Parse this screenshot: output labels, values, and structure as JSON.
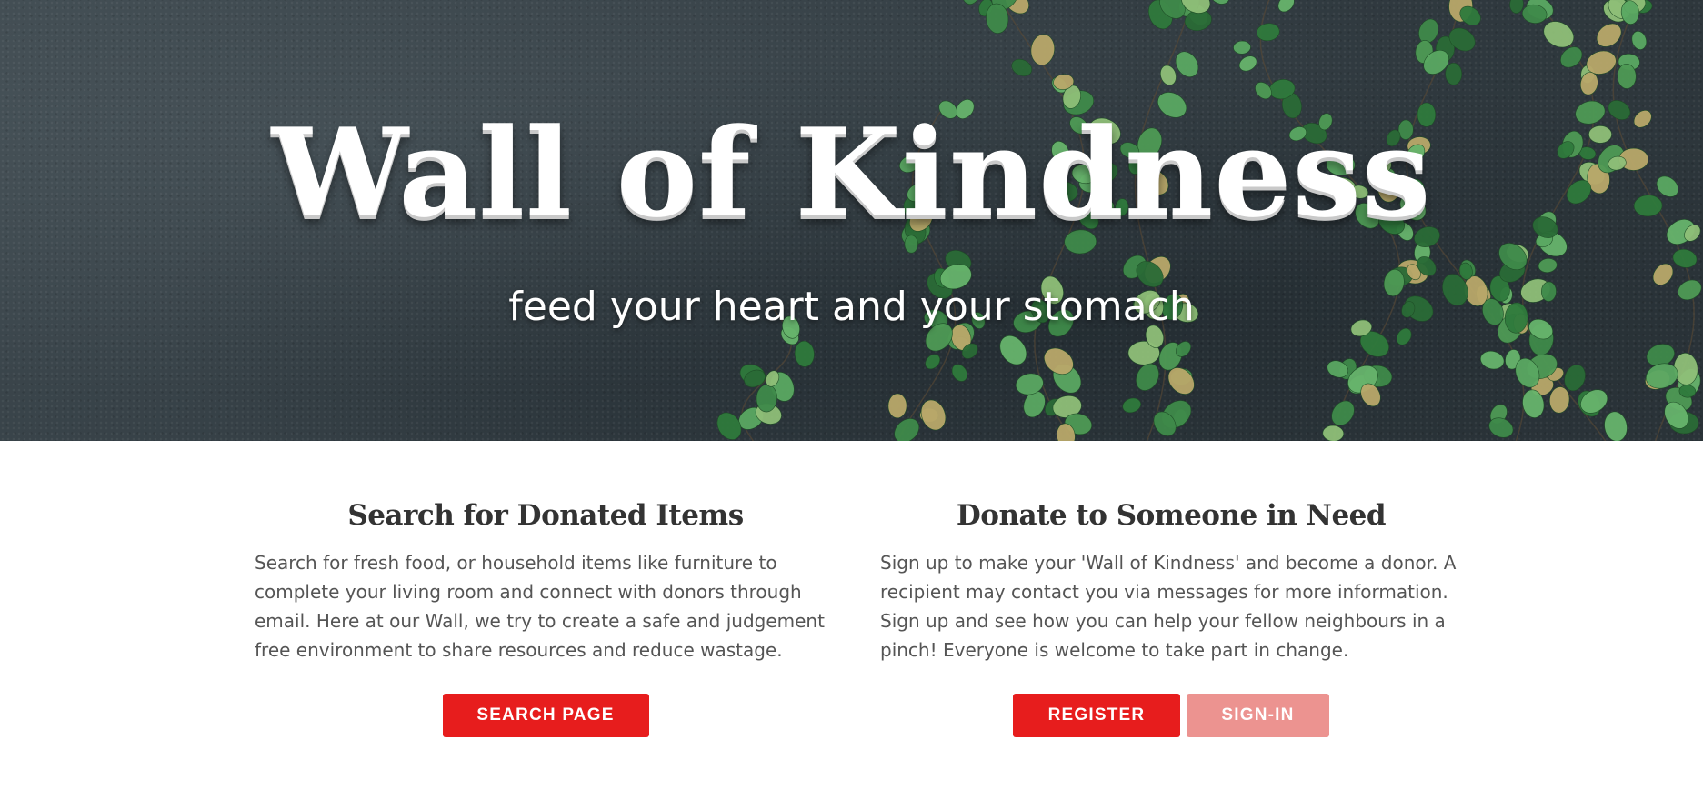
{
  "hero": {
    "title": "Wall of Kindness",
    "tagline": "feed your heart and your stomach"
  },
  "search_section": {
    "heading": "Search for Donated Items",
    "body": "Search for fresh food, or household items like furniture to complete your living room and connect with donors through email. Here at our Wall, we try to create a safe and judgement free environment to share resources and reduce wastage.",
    "button_label": "SEARCH PAGE"
  },
  "donate_section": {
    "heading": "Donate to Someone in Need",
    "body": "Sign up to make your 'Wall of Kindness' and become a donor. A recipient may contact you via messages for more information. Sign up and see how you can help your fellow neighbours in a pinch! Everyone is welcome to take part in change.",
    "register_label": "REGISTER",
    "signin_label": "SIGN-IN"
  },
  "colors": {
    "primary_button": "#e71d1d",
    "muted_button": "#ec9390",
    "hero_background": "#3a454b",
    "leaf_green": "#3f8a4a",
    "heading_text": "#333333",
    "body_text": "#555555"
  }
}
